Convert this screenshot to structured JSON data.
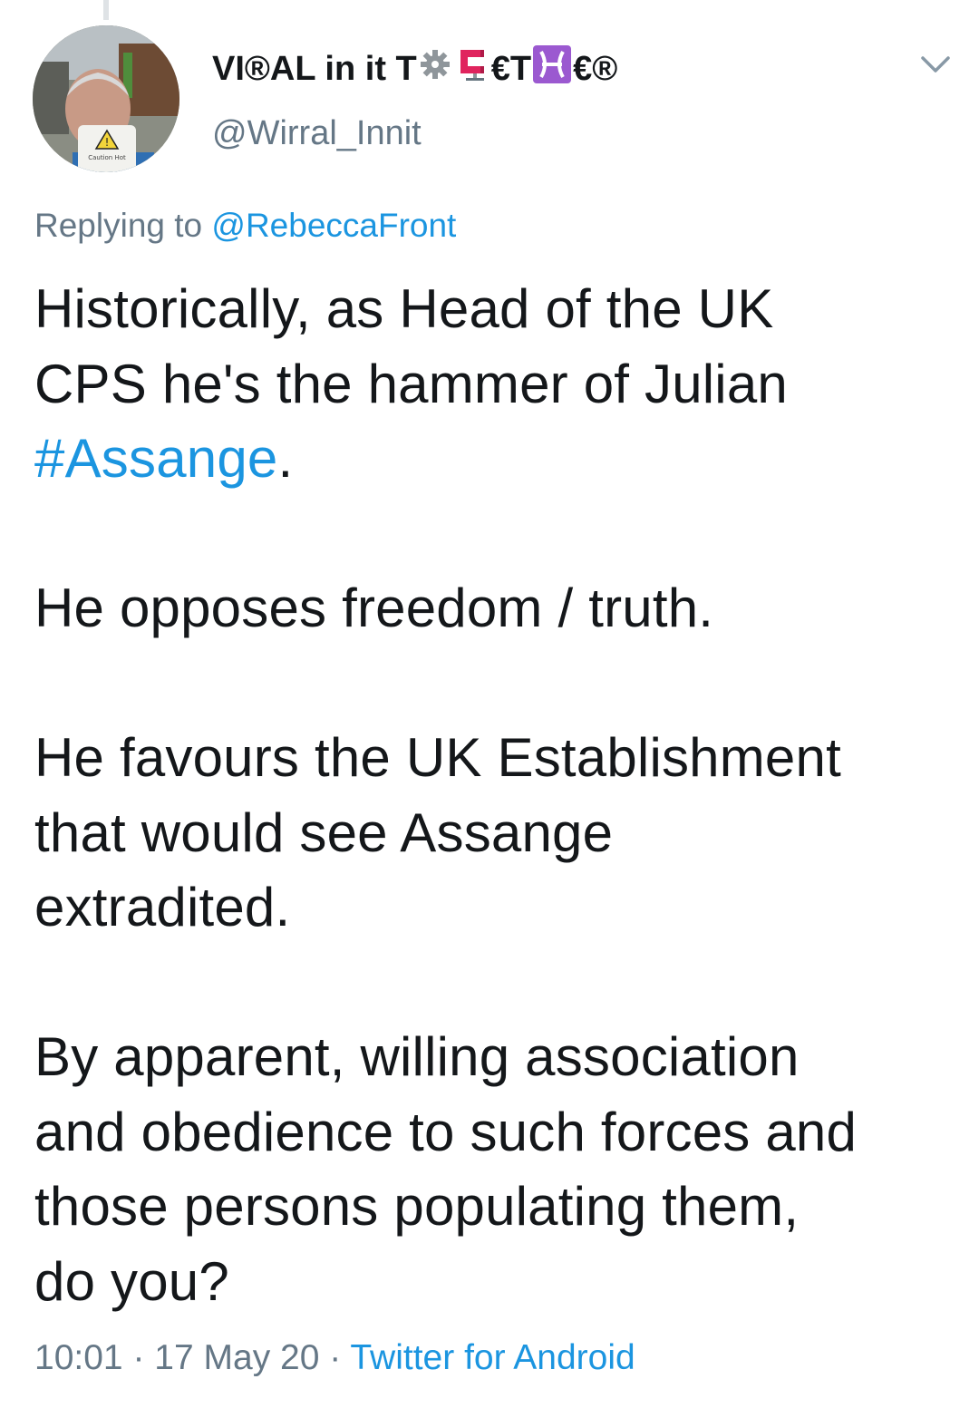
{
  "tweet": {
    "display_name_prefix": "VI®AL in it T",
    "display_name_mid1": "€T",
    "display_name_suffix": "€®",
    "display_name_icons": [
      "gear-icon",
      "c-clamp-icon",
      "pisces-icon"
    ],
    "handle": "@Wirral_Innit",
    "reply_prefix": "Replying to",
    "reply_to": "@RebeccaFront",
    "body_line1": "Historically, as Head of the UK",
    "body_line2": "CPS he's the hammer of Julian",
    "hashtag": "#Assange",
    "hashtag_tail": ".",
    "paragraph2": "He opposes freedom / truth.",
    "paragraph3": "He favours the UK Establishment\nthat would see Assange\nextradited.",
    "paragraph4": "By apparent, willing association\nand obedience to such forces and\nthose persons populating them,\ndo you?",
    "time": "10:01",
    "date": "17 May 20",
    "separator": "·",
    "source": "Twitter for Android",
    "mug_text": "Caution Hot",
    "colors": {
      "link": "#1b95e0",
      "muted": "#657786",
      "text": "#14171a",
      "pisces": "#9b59d0",
      "clamp": "#e0245e"
    }
  }
}
